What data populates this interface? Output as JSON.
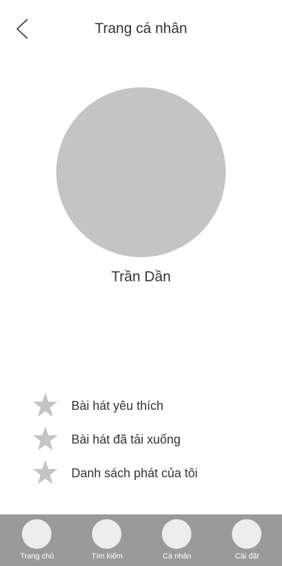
{
  "header": {
    "back_icon": "chevron-left-icon",
    "title": "Trang cá nhân"
  },
  "profile": {
    "name": "Trần Dần"
  },
  "menu": {
    "items": [
      {
        "icon": "star-icon",
        "label": "Bài hát yêu thích"
      },
      {
        "icon": "star-icon",
        "label": "Bài hát đã tải xuống"
      },
      {
        "icon": "star-icon",
        "label": "Danh sách phát của tôi"
      }
    ]
  },
  "bottom_nav": {
    "items": [
      {
        "label": "Trang chủ"
      },
      {
        "label": "Tìm kiếm"
      },
      {
        "label": "Cá nhân"
      },
      {
        "label": "Cài đặt"
      }
    ]
  },
  "colors": {
    "placeholder_gray": "#c4c4c4",
    "nav_background": "#9a9a9a",
    "nav_circle": "#ededed",
    "text": "#333333"
  }
}
